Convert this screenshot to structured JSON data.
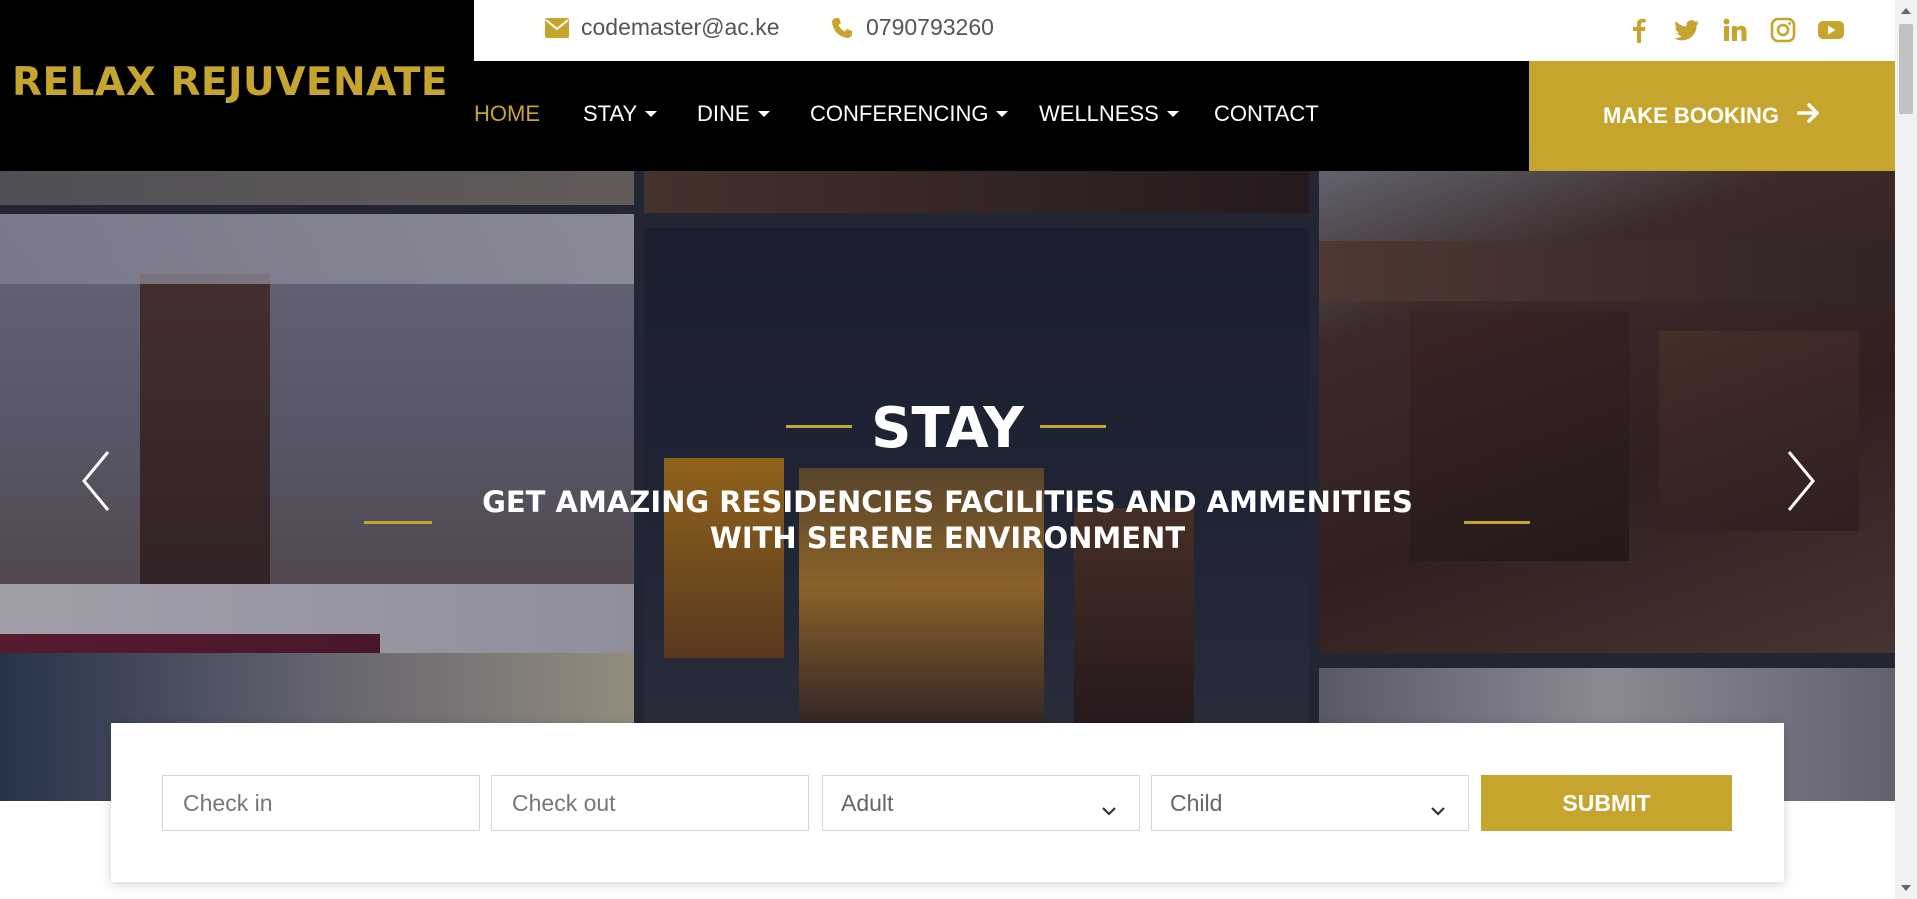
{
  "brand": {
    "name": "RELAX REJUVENATE",
    "accent": "#c6a52f"
  },
  "contact": {
    "email": "codemaster@ac.ke",
    "phone": "0790793260"
  },
  "socials": [
    "facebook-icon",
    "twitter-icon",
    "linkedin-icon",
    "instagram-icon",
    "youtube-icon"
  ],
  "nav": {
    "home": "HOME",
    "stay": "STAY",
    "dine": "DINE",
    "conferencing": "CONFERENCING",
    "wellness": "WELLNESS",
    "contact": "CONTACT"
  },
  "booking_button": "MAKE BOOKING",
  "hero": {
    "title": "STAY",
    "subtitle_line1": "GET AMAZING RESIDENCIES FACILITIES AND AMMENITIES",
    "subtitle_line2": "WITH SERENE ENVIRONMENT"
  },
  "form": {
    "checkin_placeholder": "Check in",
    "checkout_placeholder": "Check out",
    "adult": "Adult",
    "child": "Child",
    "submit": "SUBMIT"
  }
}
